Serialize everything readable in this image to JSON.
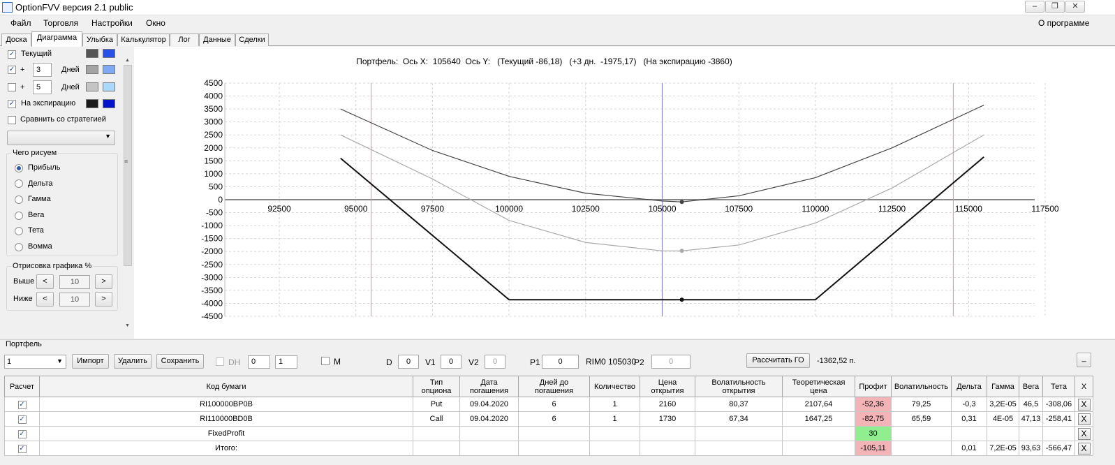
{
  "window": {
    "title": "OptionFVV версия 2.1 public"
  },
  "menu": {
    "items": [
      "Файл",
      "Торговля",
      "Настройки",
      "Окно"
    ],
    "about": "О программе"
  },
  "tabs": [
    "Доска",
    "Диаграмма",
    "Улыбка",
    "Калькулятор",
    "Лог",
    "Данные",
    "Сделки"
  ],
  "left": {
    "current_label": "Текущий",
    "plus_sign": "+",
    "days_label": "Дней",
    "days1": "3",
    "days2": "5",
    "expiry_label": "На экспирацию",
    "compare_label": "Сравнить со стратегией",
    "draw_group": "Чего рисуем",
    "draw_options": [
      "Прибыль",
      "Дельта",
      "Гамма",
      "Вега",
      "Тета",
      "Вомма"
    ],
    "plot_group": "Отрисовка графика %",
    "above_label": "Выше",
    "below_label": "Ниже",
    "above_value": "10",
    "below_value": "10",
    "btn_left": "<",
    "btn_right": ">",
    "colors": {
      "current_gray": "#555555",
      "current_blue": "#2a50e8",
      "d1_gray": "#a3a3a3",
      "d1_blue": "#7fa9f2",
      "d2_gray": "#c4c4c4",
      "d2_blue": "#aad8f8",
      "exp_black": "#1a1a1a",
      "exp_blue": "#0614c9"
    }
  },
  "chart_data": {
    "type": "line",
    "title": "Портфель:  Ось X:  105640  Ось Y:   (Текущий -86,18)   (+3 дн.  -1975,17)   (На экспирацию -3860)",
    "xlim": [
      92500,
      117500
    ],
    "ylim": [
      -4500,
      4500
    ],
    "xticks": [
      92500,
      95000,
      97500,
      100000,
      102500,
      105000,
      107500,
      110000,
      112500,
      115000,
      117500
    ],
    "yticks": [
      4500,
      4000,
      3500,
      3000,
      2500,
      2000,
      1500,
      1000,
      500,
      0,
      -500,
      -1000,
      -1500,
      -2000,
      -2500,
      -3000,
      -3500,
      -4000,
      -4500
    ],
    "red_lines_x": [
      95500,
      114500
    ],
    "cursor_x": 105000,
    "grid": true,
    "series": [
      {
        "color": "#444444",
        "x": [
          94500,
          97500,
          100000,
          102500,
          105000,
          105640,
          107500,
          110000,
          112500,
          115500
        ],
        "y": [
          3500,
          1900,
          900,
          250,
          -50,
          -86,
          150,
          850,
          2000,
          3650
        ]
      },
      {
        "color": "#aaaaaa",
        "x": [
          94500,
          97500,
          100000,
          102500,
          105000,
          105640,
          107500,
          110000,
          112500,
          115500
        ],
        "y": [
          2500,
          800,
          -800,
          -1650,
          -1975,
          -1975,
          -1750,
          -900,
          450,
          2500
        ]
      },
      {
        "color": "#111111",
        "x": [
          94500,
          100000,
          105640,
          110000,
          115500
        ],
        "y": [
          1600,
          -3860,
          -3860,
          -3860,
          1650
        ]
      }
    ],
    "points": [
      {
        "x": 105640,
        "y": -86,
        "color": "#444444"
      },
      {
        "x": 105640,
        "y": -1975,
        "color": "#aaaaaa"
      },
      {
        "x": 105640,
        "y": -3860,
        "color": "#111111"
      }
    ]
  },
  "portfolio": {
    "group_label": "Портфель",
    "select_value": "1",
    "import": "Импорт",
    "delete": "Удалить",
    "save": "Сохранить",
    "dh_label": "DH",
    "dh_v1": "0",
    "dh_v2": "1",
    "m_label": "M",
    "d_label": "D",
    "d_value": "0",
    "v1_label": "V1",
    "v1_value": "0",
    "v2_label": "V2",
    "v2_value": "0",
    "p1_label": "P1",
    "p1_value": "0",
    "rim_label": "RIM0 105030",
    "p2_label": "P2",
    "p2_value": "0",
    "calc_go": "Рассчитать ГО",
    "go_value": "-1362,52 п.",
    "minimize": "_"
  },
  "table": {
    "headers": [
      "Расчет",
      "Код бумаги",
      "Тип опциона",
      "Дата погашения",
      "Дней до погашения",
      "Количество",
      "Цена открытия",
      "Волатильность открытия",
      "Теоретическая цена",
      "Профит",
      "Волатильность",
      "Дельта",
      "Гамма",
      "Вега",
      "Тета",
      "X"
    ],
    "rows": [
      [
        "✓",
        "RI100000BP0B",
        "Put",
        "09.04.2020",
        "6",
        "1",
        "2160",
        "80,37",
        "2107,64",
        "-52,36",
        "79,25",
        "-0,3",
        "3,2E-05",
        "46,5",
        "-308,06",
        "X"
      ],
      [
        "✓",
        "RI110000BD0B",
        "Call",
        "09.04.2020",
        "6",
        "1",
        "1730",
        "67,34",
        "1647,25",
        "-82,75",
        "65,59",
        "0,31",
        "4E-05",
        "47,13",
        "-258,41",
        "X"
      ],
      [
        "✓",
        "FixedProfit",
        "",
        "",
        "",
        "",
        "",
        "",
        "",
        "30",
        "",
        "",
        "",
        "",
        "",
        "X"
      ],
      [
        "✓",
        "Итого:",
        "",
        "",
        "",
        "",
        "",
        "",
        "",
        "-105,11",
        "",
        "0,01",
        "7,2E-05",
        "93,63",
        "-566,47",
        "X"
      ]
    ]
  }
}
